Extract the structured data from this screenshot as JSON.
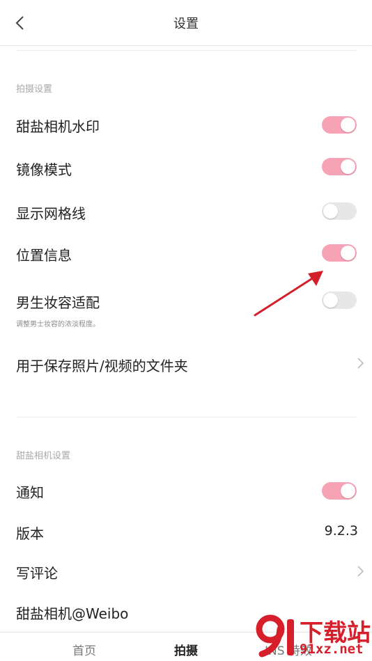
{
  "header": {
    "title": "设置"
  },
  "sections": {
    "shooting": {
      "title": "拍摄设置",
      "items": [
        {
          "label": "甜盐相机水印",
          "toggle": "on"
        },
        {
          "label": "镜像模式",
          "toggle": "on"
        },
        {
          "label": "显示网格线",
          "toggle": "off"
        },
        {
          "label": "位置信息",
          "toggle": "on"
        },
        {
          "label": "男生妆容适配",
          "sub": "调整男士妆容的浓淡程度。",
          "toggle": "off"
        },
        {
          "label": "用于保存照片/视频的文件夹"
        }
      ]
    },
    "app": {
      "title": "甜盐相机设置",
      "items": [
        {
          "label": "通知",
          "toggle": "on"
        },
        {
          "label": "版本",
          "value": "9.2.3"
        },
        {
          "label": "写评论"
        },
        {
          "label": "甜盐相机@Weibo"
        }
      ]
    }
  },
  "tabbar": {
    "items": [
      "首页",
      "拍摄",
      "INS 特效"
    ],
    "active_index": 1
  },
  "watermark": {
    "line1": "下载站",
    "line2": "91xz.net"
  },
  "colors": {
    "toggle_on": "#f7a3b6",
    "toggle_off": "#e7e7e7",
    "arrow": "#d21f2a"
  }
}
